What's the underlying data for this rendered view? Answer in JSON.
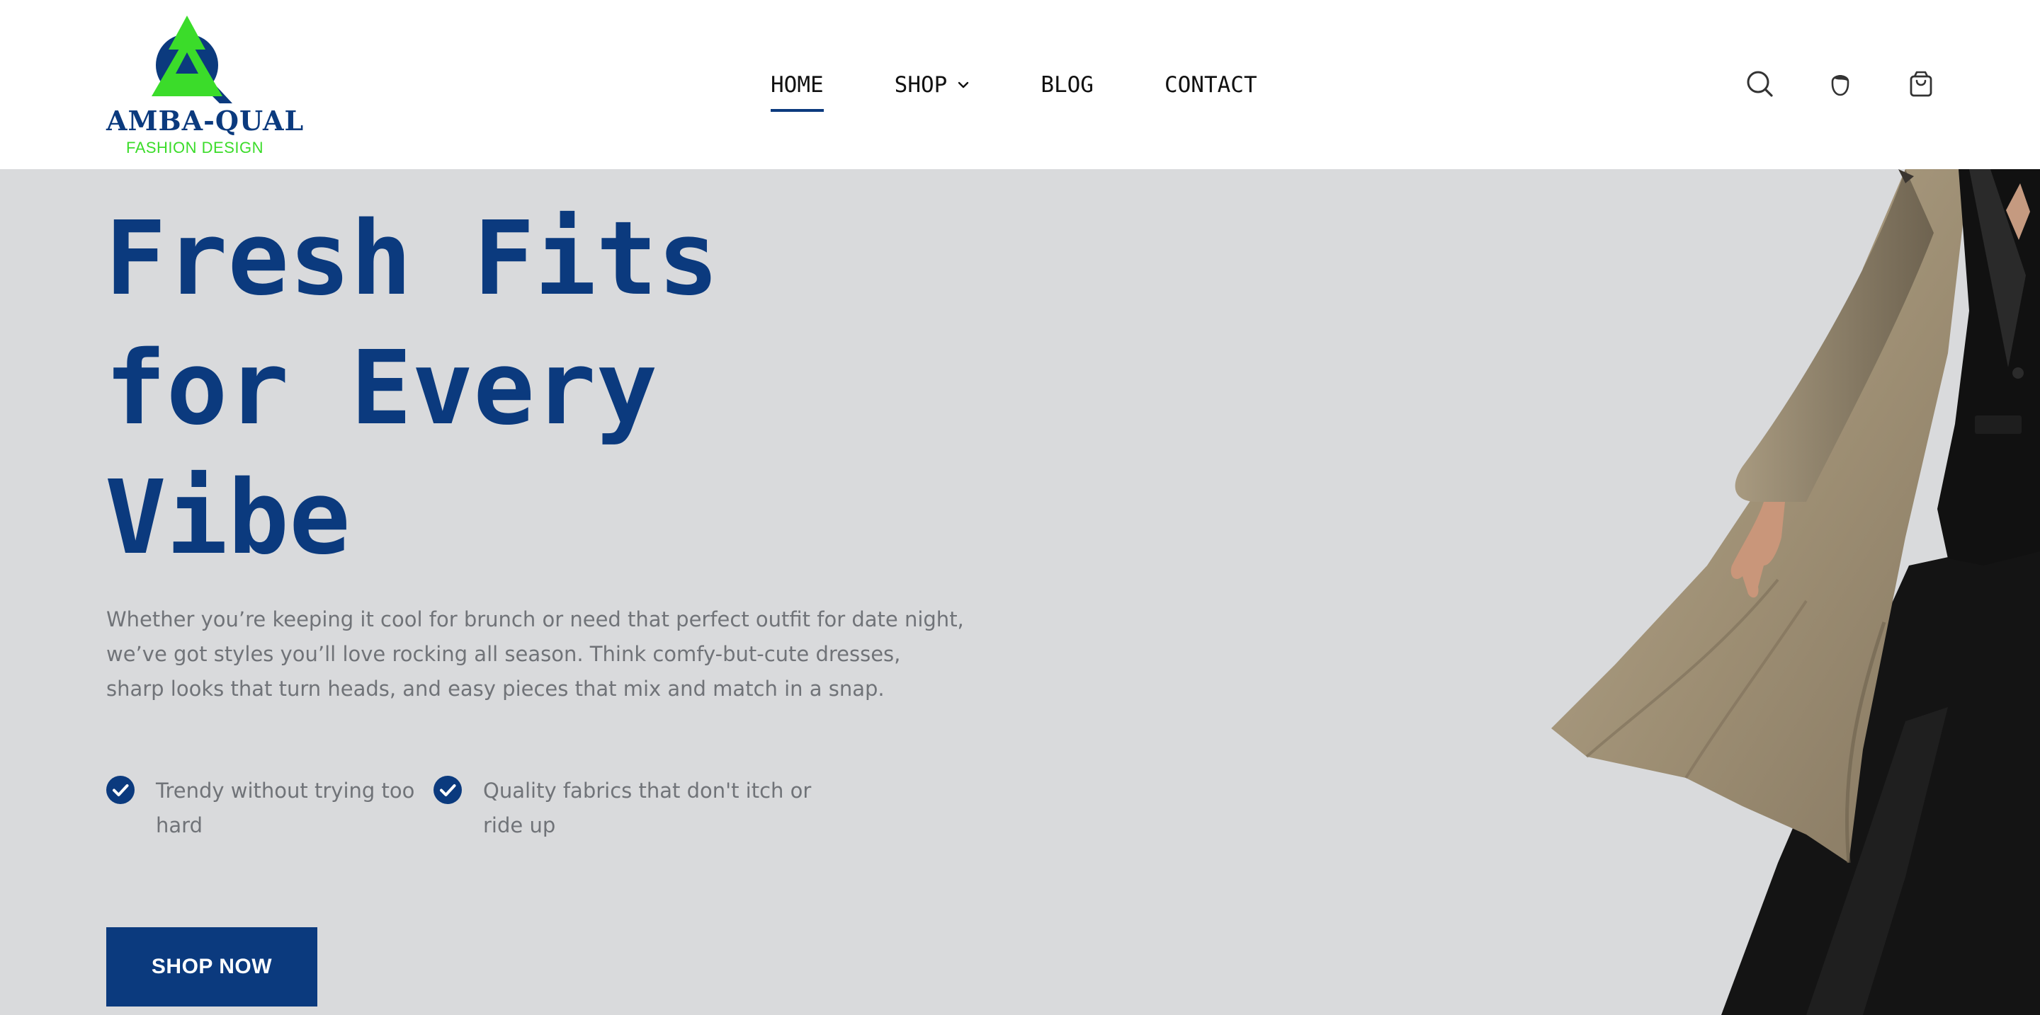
{
  "brand": {
    "name": "AMBA-QUAL",
    "tagline": "FASHION DESIGN",
    "colors": {
      "primary": "#0b3a7e",
      "accent": "#3bdc2a"
    }
  },
  "nav": {
    "items": [
      {
        "label": "HOME",
        "active": true
      },
      {
        "label": "SHOP",
        "has_dropdown": true
      },
      {
        "label": "BLOG"
      },
      {
        "label": "CONTACT"
      }
    ]
  },
  "header_icons": [
    "search-icon",
    "account-icon",
    "cart-icon"
  ],
  "hero": {
    "title_lines": [
      "Fresh Fits",
      "for Every",
      "Vibe"
    ],
    "description_lines": [
      "Whether you’re keeping it cool for brunch or need that perfect outfit for date night,",
      "we’ve got styles you’ll love rocking all season. Think comfy-but-cute dresses,",
      "sharp looks that turn heads, and easy pieces that mix and match in a snap."
    ],
    "features": [
      {
        "icon": "check-circle-icon",
        "lines": [
          "Trendy without trying too",
          "hard"
        ]
      },
      {
        "icon": "check-circle-icon",
        "lines": [
          "Quality fabrics that don't itch or",
          "ride up"
        ]
      }
    ],
    "cta_label": "SHOP NOW",
    "image": "model-walking-in-beige-coat-and-black-suit"
  }
}
